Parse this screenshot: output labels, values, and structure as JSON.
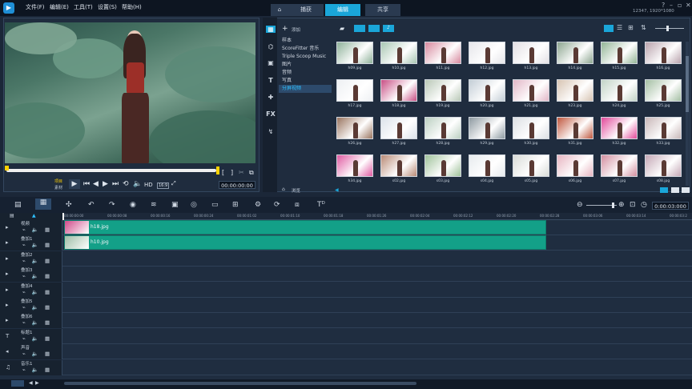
{
  "menu": [
    "文件(F)",
    "编辑(E)",
    "工具(T)",
    "设置(S)",
    "帮助(H)"
  ],
  "tabs": {
    "capture": "捕获",
    "edit": "编辑",
    "share": "共享"
  },
  "resolution_readout": "12347, 1920*1080",
  "player": {
    "timecode": "00:00:00:00",
    "project_label": "项目",
    "clip_label": "素材",
    "hd_label": "HD",
    "aspect_label": "16:9"
  },
  "library": {
    "add_label": "添加",
    "browse_label": "浏览",
    "items": [
      "样本",
      "ScoreFitter 音乐",
      "Triple Scoop Music",
      "图片",
      "音频",
      "写真",
      "分屏视频"
    ],
    "selected_index": 6,
    "thumbnails": [
      {
        "name": "h09.jpg",
        "color": "#8fb29a"
      },
      {
        "name": "h10.jpg",
        "color": "#a9c7b3"
      },
      {
        "name": "h11.jpg",
        "color": "#d7899e"
      },
      {
        "name": "h12.jpg",
        "color": "#e6e6ea"
      },
      {
        "name": "h13.jpg",
        "color": "#e3e0e4"
      },
      {
        "name": "h14.jpg",
        "color": "#8da690"
      },
      {
        "name": "h15.jpg",
        "color": "#93b596"
      },
      {
        "name": "h16.jpg",
        "color": "#b9a3ad"
      },
      {
        "name": "h17.jpg",
        "color": "#eef0f3"
      },
      {
        "name": "h18.jpg",
        "color": "#c84f84"
      },
      {
        "name": "h19.jpg",
        "color": "#b9c8b7"
      },
      {
        "name": "h20.jpg",
        "color": "#c4ced6"
      },
      {
        "name": "h21.jpg",
        "color": "#e2b7c7"
      },
      {
        "name": "h23.jpg",
        "color": "#d7c4b3"
      },
      {
        "name": "h24.jpg",
        "color": "#c2d3c6"
      },
      {
        "name": "h25.jpg",
        "color": "#a4bfa3"
      },
      {
        "name": "h26.jpg",
        "color": "#9a7560"
      },
      {
        "name": "h27.jpg",
        "color": "#dce3ea"
      },
      {
        "name": "h28.jpg",
        "color": "#bcd0c2"
      },
      {
        "name": "h29.jpg",
        "color": "#8e9aa1"
      },
      {
        "name": "h30.jpg",
        "color": "#dde0e4"
      },
      {
        "name": "h31.jpg",
        "color": "#c0593f"
      },
      {
        "name": "h32.jpg",
        "color": "#e24a9a"
      },
      {
        "name": "h33.jpg",
        "color": "#c9b8b9"
      },
      {
        "name": "h34.jpg",
        "color": "#e05ba2"
      },
      {
        "name": "s02.jpg",
        "color": "#b98a76"
      },
      {
        "name": "s03.jpg",
        "color": "#9fc29a"
      },
      {
        "name": "s04.jpg",
        "color": "#e7ebee"
      },
      {
        "name": "s05.jpg",
        "color": "#d9dcd8"
      },
      {
        "name": "s06.jpg",
        "color": "#e8b6c2"
      },
      {
        "name": "s07.jpg",
        "color": "#d38fa0"
      },
      {
        "name": "s08.jpg",
        "color": "#c5a8b6"
      }
    ]
  },
  "timeline": {
    "timecode": "0:00:03:000",
    "ruler": [
      "00:00:00:00",
      "00:00:00:08",
      "00:00:00:16",
      "00:00:00:24",
      "00:00:01:02",
      "00:00:01:10",
      "00:00:01:18",
      "00:00:01:26",
      "00:00:02:04",
      "00:00:02:12",
      "00:00:02:20",
      "00:00:02:28",
      "00:00:03:06",
      "00:00:03:14",
      "00:00:03:2"
    ],
    "tracks": [
      "视频",
      "叠加1",
      "叠加2",
      "叠加3",
      "叠加4",
      "叠加5",
      "叠加6",
      "标题1",
      "声音",
      "音乐1"
    ],
    "clips": [
      {
        "label": "h18.jpg",
        "color": "#d04b8a"
      },
      {
        "label": "h10.jpg",
        "color": "#9fbea7"
      }
    ]
  },
  "colors": {
    "accent": "#1aa6d9",
    "clip": "#13a088",
    "selected_text": "#2ec0ff"
  }
}
